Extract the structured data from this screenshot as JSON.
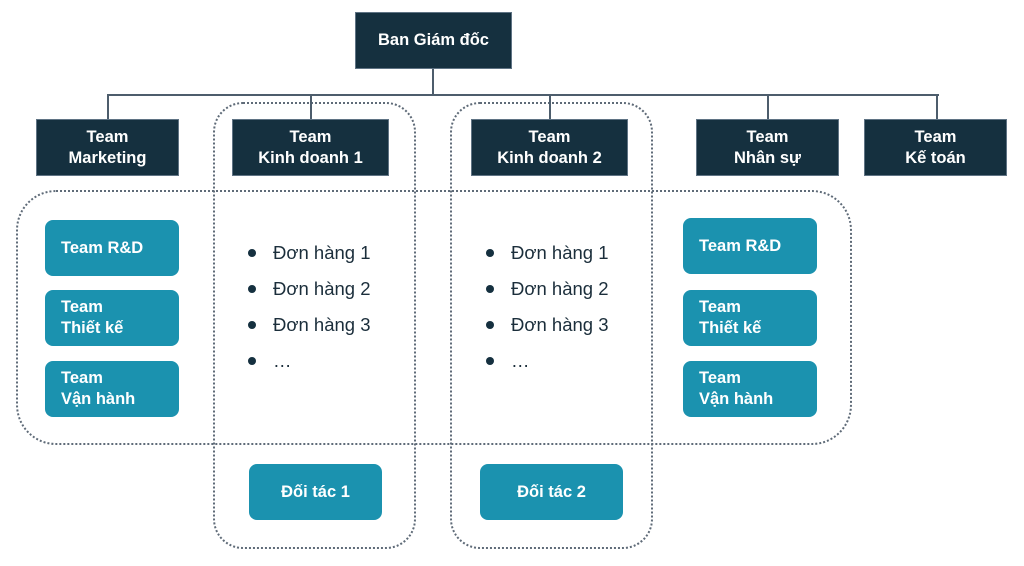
{
  "diagram": {
    "type": "org-chart",
    "colors": {
      "executive_fill": "#15303f",
      "sub_team_fill": "#1b92af",
      "connector": "#4d5d6c",
      "dotted_group": "#5f6b78",
      "text_light": "#ffffff",
      "text_dark": "#1b2e3b"
    },
    "root": {
      "label": "Ban Giám đốc"
    },
    "teams": [
      {
        "line1": "Team",
        "line2": "Marketing"
      },
      {
        "line1": "Team",
        "line2": "Kinh doanh 1"
      },
      {
        "line1": "Team",
        "line2": "Kinh doanh 2"
      },
      {
        "line1": "Team",
        "line2": "Nhân sự"
      },
      {
        "line1": "Team",
        "line2": "Kế toán"
      }
    ],
    "shared_groups": {
      "left": [
        {
          "line1": "Team R&D",
          "line2": ""
        },
        {
          "line1": "Team",
          "line2": "Thiết kế"
        },
        {
          "line1": "Team",
          "line2": "Vận hành"
        }
      ],
      "right": [
        {
          "line1": "Team R&D",
          "line2": ""
        },
        {
          "line1": "Team",
          "line2": "Thiết kế"
        },
        {
          "line1": "Team",
          "line2": "Vận hành"
        }
      ]
    },
    "sales_1": {
      "orders": [
        "Đơn hàng 1",
        "Đơn hàng 2",
        "Đơn hàng 3",
        "…"
      ],
      "partner": "Đối tác 1"
    },
    "sales_2": {
      "orders": [
        "Đơn hàng 1",
        "Đơn hàng 2",
        "Đơn hàng 3",
        "…"
      ],
      "partner": "Đối tác 2"
    }
  }
}
